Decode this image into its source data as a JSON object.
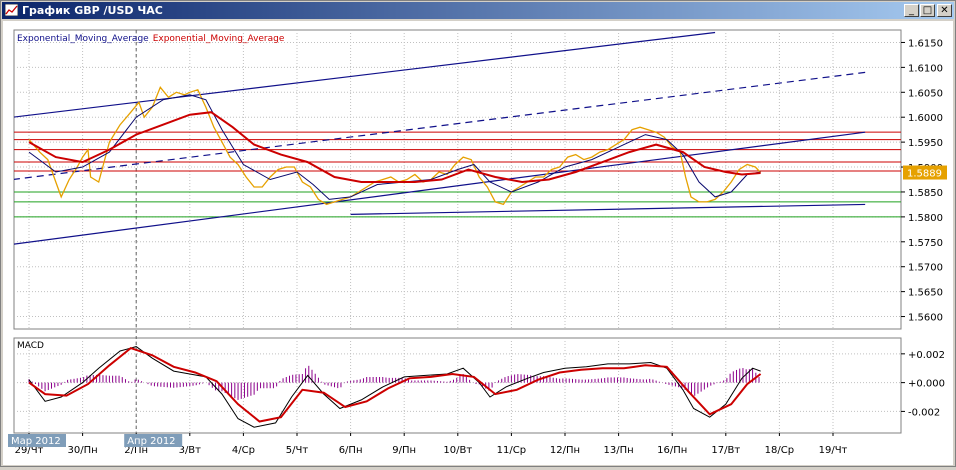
{
  "window": {
    "title": "График GBP /USD ЧАС",
    "controls": {
      "minimize": "_",
      "maximize": "□",
      "close": "✕"
    }
  },
  "colors": {
    "price": "#e6a100",
    "ema_fast": "#0a0a6e",
    "ema_slow": "#cc0000",
    "channel": "#10108a",
    "hline_red": "#cc0000",
    "hline_green": "#1fa01f",
    "current_price_bg": "#e6a100",
    "macd_hist": "#8b008b",
    "macd_line": "#000000",
    "macd_signal": "#cc0000",
    "grid": "#c0c0c0"
  },
  "chart_data": [
    {
      "type": "line",
      "symbol": "GBP/USD",
      "legend": [
        {
          "name": "Exponential_Moving_Average",
          "color": "#10108a"
        },
        {
          "name": "Exponential_Moving_Average",
          "color": "#cc0000"
        }
      ],
      "legend_placement": "top-left",
      "grid": true,
      "ylim": [
        1.5575,
        1.6175
      ],
      "y_ticks": [
        "1.6150",
        "1.6100",
        "1.6050",
        "1.6000",
        "1.5950",
        "1.5900",
        "1.5850",
        "1.5800",
        "1.5750",
        "1.5700",
        "1.5650",
        "1.5600"
      ],
      "current_price_label": "1.5889",
      "current_price": 1.5889,
      "x_tick_labels": [
        "29/Чт",
        "30/Пн",
        "2/Пн",
        "3/Вт",
        "4/Ср",
        "5/Чт",
        "6/Пн",
        "9/Пн",
        "10/Вт",
        "11/Ср",
        "12/Пн",
        "13/Пн",
        "16/Пн",
        "17/Вт",
        "18/Ср",
        "19/Чт"
      ],
      "month_labels": [
        {
          "label": "Мар 2012",
          "at_index": 0
        },
        {
          "label": "Апр 2012",
          "at_index": 2
        }
      ],
      "price_series": [
        [
          0,
          1.5955
        ],
        [
          0.2,
          1.593
        ],
        [
          0.35,
          1.5915
        ],
        [
          0.5,
          1.587
        ],
        [
          0.6,
          1.584
        ],
        [
          0.75,
          1.5875
        ],
        [
          0.9,
          1.59
        ],
        [
          1.0,
          1.592
        ],
        [
          1.1,
          1.5935
        ],
        [
          1.15,
          1.588
        ],
        [
          1.3,
          1.587
        ],
        [
          1.5,
          1.595
        ],
        [
          1.7,
          1.5985
        ],
        [
          1.9,
          1.601
        ],
        [
          2.05,
          1.603
        ],
        [
          2.15,
          1.6
        ],
        [
          2.3,
          1.602
        ],
        [
          2.45,
          1.606
        ],
        [
          2.6,
          1.604
        ],
        [
          2.75,
          1.605
        ],
        [
          2.9,
          1.6045
        ],
        [
          3.0,
          1.605
        ],
        [
          3.15,
          1.6055
        ],
        [
          3.3,
          1.602
        ],
        [
          3.45,
          1.598
        ],
        [
          3.6,
          1.595
        ],
        [
          3.75,
          1.592
        ],
        [
          3.9,
          1.5905
        ],
        [
          4.05,
          1.588
        ],
        [
          4.2,
          1.586
        ],
        [
          4.35,
          1.586
        ],
        [
          4.5,
          1.588
        ],
        [
          4.65,
          1.5895
        ],
        [
          4.8,
          1.59
        ],
        [
          4.95,
          1.59
        ],
        [
          5.1,
          1.587
        ],
        [
          5.25,
          1.586
        ],
        [
          5.4,
          1.5835
        ],
        [
          5.55,
          1.5825
        ],
        [
          5.7,
          1.583
        ],
        [
          5.85,
          1.5835
        ],
        [
          6.0,
          1.584
        ],
        [
          6.15,
          1.585
        ],
        [
          6.3,
          1.586
        ],
        [
          6.45,
          1.587
        ],
        [
          6.6,
          1.5875
        ],
        [
          6.75,
          1.588
        ],
        [
          6.9,
          1.587
        ],
        [
          7.05,
          1.5875
        ],
        [
          7.2,
          1.5885
        ],
        [
          7.35,
          1.587
        ],
        [
          7.5,
          1.5875
        ],
        [
          7.65,
          1.589
        ],
        [
          7.8,
          1.5885
        ],
        [
          7.95,
          1.5905
        ],
        [
          8.1,
          1.592
        ],
        [
          8.25,
          1.5915
        ],
        [
          8.4,
          1.588
        ],
        [
          8.55,
          1.586
        ],
        [
          8.7,
          1.583
        ],
        [
          8.85,
          1.5825
        ],
        [
          9.0,
          1.585
        ],
        [
          9.15,
          1.586
        ],
        [
          9.3,
          1.587
        ],
        [
          9.45,
          1.588
        ],
        [
          9.6,
          1.588
        ],
        [
          9.75,
          1.5895
        ],
        [
          9.9,
          1.59
        ],
        [
          10.05,
          1.592
        ],
        [
          10.2,
          1.5925
        ],
        [
          10.35,
          1.5915
        ],
        [
          10.5,
          1.592
        ],
        [
          10.65,
          1.593
        ],
        [
          10.8,
          1.5935
        ],
        [
          10.95,
          1.5945
        ],
        [
          11.1,
          1.5955
        ],
        [
          11.25,
          1.5975
        ],
        [
          11.4,
          1.598
        ],
        [
          11.55,
          1.5975
        ],
        [
          11.7,
          1.597
        ],
        [
          11.85,
          1.596
        ],
        [
          12.0,
          1.594
        ],
        [
          12.15,
          1.593
        ],
        [
          12.25,
          1.588
        ],
        [
          12.35,
          1.584
        ],
        [
          12.5,
          1.583
        ],
        [
          12.65,
          1.583
        ],
        [
          12.8,
          1.5835
        ],
        [
          12.95,
          1.585
        ],
        [
          13.1,
          1.587
        ],
        [
          13.25,
          1.5895
        ],
        [
          13.4,
          1.5905
        ],
        [
          13.55,
          1.59
        ],
        [
          13.65,
          1.5889
        ]
      ],
      "ema_fast_series": [
        [
          0,
          1.593
        ],
        [
          0.5,
          1.589
        ],
        [
          1.0,
          1.59
        ],
        [
          1.5,
          1.593
        ],
        [
          2.0,
          1.6
        ],
        [
          2.5,
          1.6035
        ],
        [
          3.0,
          1.6045
        ],
        [
          3.3,
          1.6035
        ],
        [
          3.6,
          1.5975
        ],
        [
          4.0,
          1.5905
        ],
        [
          4.5,
          1.5875
        ],
        [
          5.0,
          1.589
        ],
        [
          5.3,
          1.5865
        ],
        [
          5.6,
          1.5835
        ],
        [
          6.0,
          1.584
        ],
        [
          6.5,
          1.5865
        ],
        [
          7.0,
          1.587
        ],
        [
          7.5,
          1.5875
        ],
        [
          8.0,
          1.5895
        ],
        [
          8.3,
          1.5905
        ],
        [
          8.6,
          1.587
        ],
        [
          9.0,
          1.585
        ],
        [
          9.5,
          1.587
        ],
        [
          10.0,
          1.59
        ],
        [
          10.5,
          1.5915
        ],
        [
          11.0,
          1.594
        ],
        [
          11.5,
          1.5965
        ],
        [
          11.9,
          1.5955
        ],
        [
          12.2,
          1.5925
        ],
        [
          12.5,
          1.587
        ],
        [
          12.8,
          1.584
        ],
        [
          13.1,
          1.585
        ],
        [
          13.4,
          1.5885
        ],
        [
          13.65,
          1.589
        ]
      ],
      "ema_slow_series": [
        [
          0,
          1.595
        ],
        [
          0.5,
          1.592
        ],
        [
          1.0,
          1.591
        ],
        [
          1.5,
          1.5935
        ],
        [
          2.0,
          1.5965
        ],
        [
          2.5,
          1.5985
        ],
        [
          3.0,
          1.6005
        ],
        [
          3.4,
          1.601
        ],
        [
          3.8,
          1.598
        ],
        [
          4.2,
          1.5945
        ],
        [
          4.7,
          1.5925
        ],
        [
          5.2,
          1.591
        ],
        [
          5.7,
          1.588
        ],
        [
          6.2,
          1.587
        ],
        [
          6.7,
          1.587
        ],
        [
          7.2,
          1.587
        ],
        [
          7.7,
          1.5875
        ],
        [
          8.2,
          1.5895
        ],
        [
          8.7,
          1.588
        ],
        [
          9.2,
          1.587
        ],
        [
          9.7,
          1.5875
        ],
        [
          10.2,
          1.589
        ],
        [
          10.7,
          1.591
        ],
        [
          11.2,
          1.593
        ],
        [
          11.7,
          1.5945
        ],
        [
          12.2,
          1.593
        ],
        [
          12.6,
          1.59
        ],
        [
          13.0,
          1.589
        ],
        [
          13.3,
          1.5885
        ],
        [
          13.65,
          1.5888
        ]
      ],
      "trend_lines": [
        {
          "style": "solid",
          "points": [
            [
              -0.3,
              1.6
            ],
            [
              12.8,
              1.617
            ]
          ]
        },
        {
          "style": "solid",
          "points": [
            [
              -0.3,
              1.5745
            ],
            [
              15.6,
              1.597
            ]
          ]
        },
        {
          "style": "dashed",
          "points": [
            [
              -0.3,
              1.5875
            ],
            [
              15.6,
              1.609
            ]
          ]
        },
        {
          "style": "solid",
          "points": [
            [
              6.0,
              1.5805
            ],
            [
              15.6,
              1.5825
            ]
          ]
        }
      ],
      "horizontal_levels": [
        {
          "value": 1.597,
          "color": "red"
        },
        {
          "value": 1.5955,
          "color": "red"
        },
        {
          "value": 1.5935,
          "color": "red"
        },
        {
          "value": 1.591,
          "color": "red"
        },
        {
          "value": 1.5892,
          "color": "red"
        },
        {
          "value": 1.585,
          "color": "green"
        },
        {
          "value": 1.583,
          "color": "green"
        },
        {
          "value": 1.58,
          "color": "green"
        }
      ]
    },
    {
      "type": "line",
      "title": "MACD",
      "grid": true,
      "ylim": [
        -0.0035,
        0.0031
      ],
      "y_ticks": [
        "+0.002",
        "+0.000",
        "-0.002"
      ],
      "macd_series": [
        [
          0,
          0.0002
        ],
        [
          0.3,
          -0.0013
        ],
        [
          0.6,
          -0.001
        ],
        [
          1.0,
          0.0
        ],
        [
          1.3,
          0.001
        ],
        [
          1.7,
          0.0022
        ],
        [
          2.0,
          0.0025
        ],
        [
          2.3,
          0.0017
        ],
        [
          2.7,
          0.0008
        ],
        [
          3.0,
          0.0006
        ],
        [
          3.3,
          0.0004
        ],
        [
          3.6,
          -0.0008
        ],
        [
          3.9,
          -0.0025
        ],
        [
          4.2,
          -0.0031
        ],
        [
          4.6,
          -0.0028
        ],
        [
          4.9,
          -0.001
        ],
        [
          5.2,
          0.0005
        ],
        [
          5.5,
          -0.0008
        ],
        [
          5.8,
          -0.0018
        ],
        [
          6.2,
          -0.0012
        ],
        [
          6.6,
          -0.0003
        ],
        [
          7.0,
          0.0004
        ],
        [
          7.4,
          0.0005
        ],
        [
          7.8,
          0.0006
        ],
        [
          8.1,
          0.001
        ],
        [
          8.4,
          0.0
        ],
        [
          8.6,
          -0.001
        ],
        [
          8.9,
          -0.0003
        ],
        [
          9.3,
          0.0003
        ],
        [
          9.6,
          0.0007
        ],
        [
          10.0,
          0.001
        ],
        [
          10.4,
          0.0011
        ],
        [
          10.8,
          0.0013
        ],
        [
          11.2,
          0.0013
        ],
        [
          11.6,
          0.0014
        ],
        [
          11.9,
          0.001
        ],
        [
          12.2,
          -0.0005
        ],
        [
          12.4,
          -0.0018
        ],
        [
          12.7,
          -0.0024
        ],
        [
          13.0,
          -0.0015
        ],
        [
          13.3,
          0.0003
        ],
        [
          13.5,
          0.001
        ],
        [
          13.65,
          0.0008
        ]
      ],
      "signal_series": [
        [
          0,
          0.0
        ],
        [
          0.3,
          -0.0008
        ],
        [
          0.7,
          -0.0009
        ],
        [
          1.1,
          -0.0001
        ],
        [
          1.5,
          0.0012
        ],
        [
          1.9,
          0.0024
        ],
        [
          2.3,
          0.0019
        ],
        [
          2.7,
          0.0011
        ],
        [
          3.1,
          0.0007
        ],
        [
          3.5,
          0.0001
        ],
        [
          3.9,
          -0.0015
        ],
        [
          4.3,
          -0.0027
        ],
        [
          4.7,
          -0.0024
        ],
        [
          5.1,
          -0.0005
        ],
        [
          5.5,
          -0.0007
        ],
        [
          5.9,
          -0.0017
        ],
        [
          6.3,
          -0.0013
        ],
        [
          6.7,
          -0.0004
        ],
        [
          7.1,
          0.0003
        ],
        [
          7.5,
          0.0004
        ],
        [
          7.9,
          0.0006
        ],
        [
          8.3,
          0.0004
        ],
        [
          8.7,
          -0.0008
        ],
        [
          9.1,
          -0.0005
        ],
        [
          9.5,
          0.0002
        ],
        [
          9.9,
          0.0007
        ],
        [
          10.3,
          0.0009
        ],
        [
          10.7,
          0.001
        ],
        [
          11.1,
          0.001
        ],
        [
          11.5,
          0.0012
        ],
        [
          11.9,
          0.0011
        ],
        [
          12.3,
          -0.0006
        ],
        [
          12.7,
          -0.0022
        ],
        [
          13.1,
          -0.0015
        ],
        [
          13.4,
          -0.0001
        ],
        [
          13.65,
          0.0006
        ]
      ]
    }
  ]
}
